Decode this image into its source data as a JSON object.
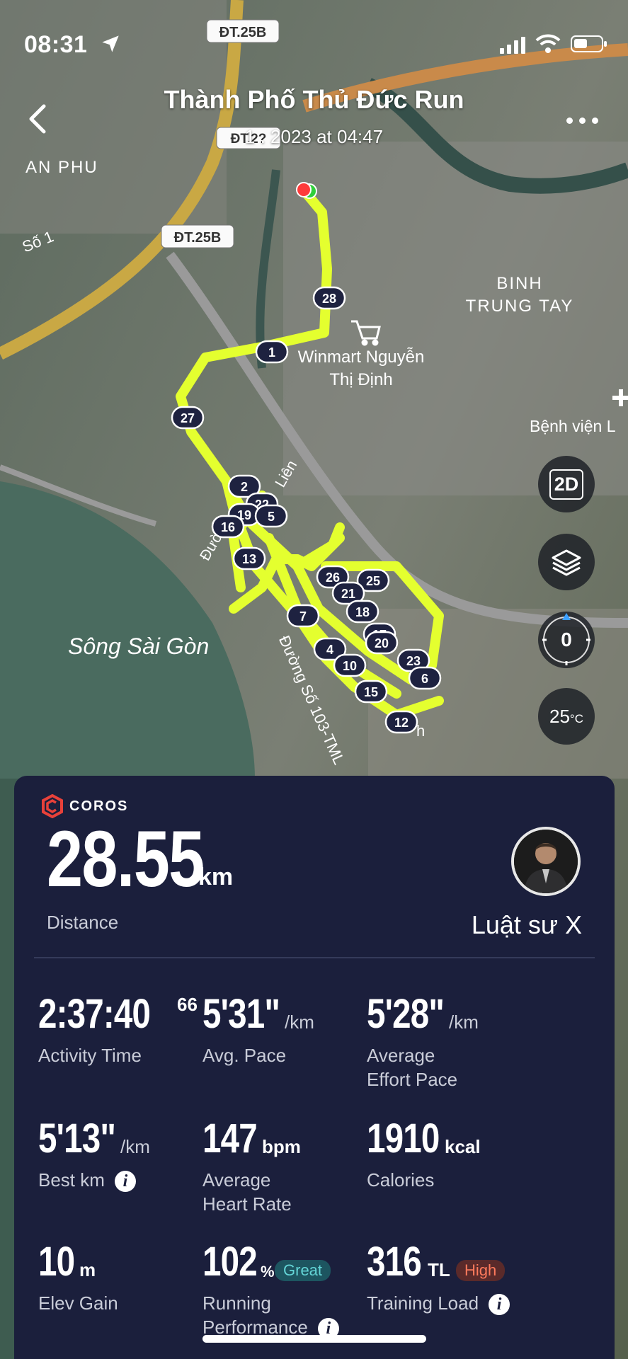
{
  "status_bar": {
    "time": "08:31"
  },
  "header": {
    "title": "Thành Phố Thủ Đức Run",
    "subtitle": "1 . 2023 at 04:47"
  },
  "map": {
    "labels": {
      "road_top": "ĐT.25B",
      "road_mid": "ĐT.25B",
      "road_sub": "ĐT.2?",
      "an_phu": "AN PHU",
      "so1": "Số 1",
      "binh_trung_tay_1": "BINH",
      "binh_trung_tay_2": "TRUNG TAY",
      "winmart_1": "Winmart Nguyễn",
      "winmart_2": "Thị Định",
      "hospital": "Bệnh viện L",
      "river": "Sông Sài Gòn",
      "street_vertical": "Đường Số 103-TML",
      "street_other_1": "Đường",
      "street_other_2": "Liên",
      "street_other_3": "h"
    },
    "markers": [
      "28",
      "1",
      "27",
      "2",
      "22",
      "19",
      "5",
      "16",
      "13",
      "26",
      "25",
      "21",
      "7",
      "18",
      "17",
      "20",
      "4",
      "23",
      "10",
      "6",
      "15",
      "12"
    ],
    "controls": {
      "view_mode": "2D",
      "compass_value": "0",
      "temperature": "25",
      "temperature_unit": "°C"
    }
  },
  "summary": {
    "brand": "COROS",
    "distance_value": "28.55",
    "distance_unit": "km",
    "distance_label": "Distance",
    "user_name": "Luật sư X",
    "metrics": {
      "activity_time": {
        "value": "2:37:40",
        "sup": "66",
        "label": "Activity Time"
      },
      "avg_pace": {
        "value": "5'31\"",
        "unit": "/km",
        "label": "Avg. Pace"
      },
      "avg_effort_pace": {
        "value": "5'28\"",
        "unit": "/km",
        "label_1": "Average",
        "label_2": "Effort Pace"
      },
      "best_km": {
        "value": "5'13\"",
        "unit": "/km",
        "label": "Best km"
      },
      "avg_hr": {
        "value": "147",
        "unit": "bpm",
        "label_1": "Average",
        "label_2": "Heart Rate"
      },
      "calories": {
        "value": "1910",
        "unit": "kcal",
        "label": "Calories"
      },
      "elev_gain": {
        "value": "10",
        "unit": "m",
        "label": "Elev Gain"
      },
      "running_perf": {
        "value": "102",
        "unit": "%",
        "badge": "Great",
        "label_1": "Running",
        "label_2": "Performance"
      },
      "training_load": {
        "value": "316",
        "unit": "TL",
        "badge": "High",
        "label": "Training Load"
      }
    }
  },
  "colors": {
    "route": "#e4ff2f",
    "card_bg": "#1b1f3c",
    "great": "#63d4d6",
    "high": "#ff7a5c",
    "brand_red": "#e8413a"
  }
}
